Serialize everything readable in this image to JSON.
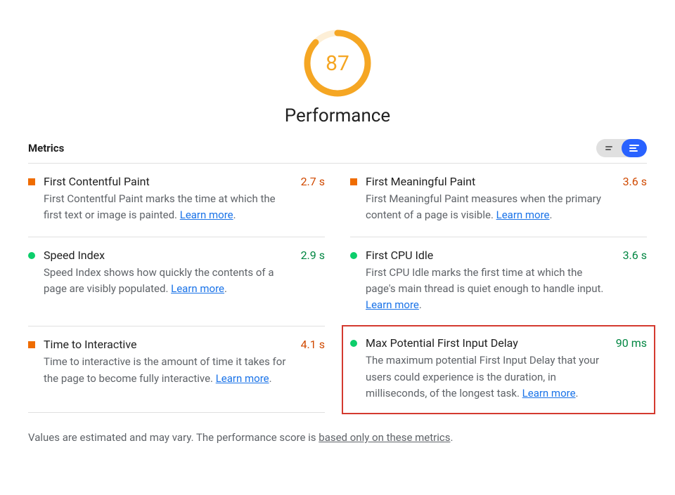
{
  "gauge": {
    "score": "87",
    "percent": 87,
    "color": "#f5a623"
  },
  "section_title": "Performance",
  "metrics_label": "Metrics",
  "learn_more": "Learn more",
  "metrics": [
    {
      "title": "First Contentful Paint",
      "value": "2.7 s",
      "status": "average",
      "desc_pre": "First Contentful Paint marks the time at which the first text or image is painted. ",
      "desc_post": "."
    },
    {
      "title": "First Meaningful Paint",
      "value": "3.6 s",
      "status": "average",
      "desc_pre": "First Meaningful Paint measures when the primary content of a page is visible. ",
      "desc_post": "."
    },
    {
      "title": "Speed Index",
      "value": "2.9 s",
      "status": "good",
      "desc_pre": "Speed Index shows how quickly the contents of a page are visibly populated. ",
      "desc_post": "."
    },
    {
      "title": "First CPU Idle",
      "value": "3.6 s",
      "status": "good",
      "desc_pre": "First CPU Idle marks the first time at which the page's main thread is quiet enough to handle input. ",
      "desc_post": "."
    },
    {
      "title": "Time to Interactive",
      "value": "4.1 s",
      "status": "average",
      "desc_pre": "Time to interactive is the amount of time it takes for the page to become fully interactive. ",
      "desc_post": "."
    },
    {
      "title": "Max Potential First Input Delay",
      "value": "90 ms",
      "status": "good",
      "highlight": true,
      "desc_pre": "The maximum potential First Input Delay that your users could experience is the duration, in milliseconds, of the longest task. ",
      "desc_post": "."
    }
  ],
  "footnote_pre": "Values are estimated and may vary. The performance score is ",
  "footnote_link": "based only on these metrics",
  "footnote_post": "."
}
